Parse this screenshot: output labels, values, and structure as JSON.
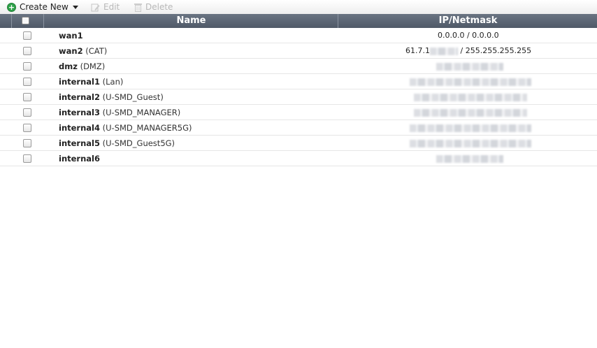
{
  "toolbar": {
    "create_new_label": "Create New",
    "edit_label": "Edit",
    "delete_label": "Delete"
  },
  "table": {
    "columns": [
      "Name",
      "IP/Netmask"
    ],
    "rows": [
      {
        "name": "wan1",
        "alias": "",
        "ip": "0.0.0.0 / 0.0.0.0"
      },
      {
        "name": "wan2",
        "alias": "(CAT)",
        "ip_prefix": "61.7.1",
        "ip_suffix": " / 255.255.255.255"
      },
      {
        "name": "dmz",
        "alias": "(DMZ)"
      },
      {
        "name": "internal1",
        "alias": "(Lan)"
      },
      {
        "name": "internal2",
        "alias": "(U-SMD_Guest)"
      },
      {
        "name": "internal3",
        "alias": "(U-SMD_MANAGER)"
      },
      {
        "name": "internal4",
        "alias": "(U-SMD_MANAGER5G)"
      },
      {
        "name": "internal5",
        "alias": "(U-SMD_Guest5G)"
      },
      {
        "name": "internal6",
        "alias": ""
      }
    ]
  },
  "colors": {
    "header_bg": "#5a6372",
    "header_text": "#ffffff",
    "create_icon": "#2fa24a"
  },
  "icons": {
    "create": "plus-circle-icon",
    "dropdown": "caret-down-icon",
    "edit": "pencil-icon",
    "delete": "trash-icon"
  }
}
